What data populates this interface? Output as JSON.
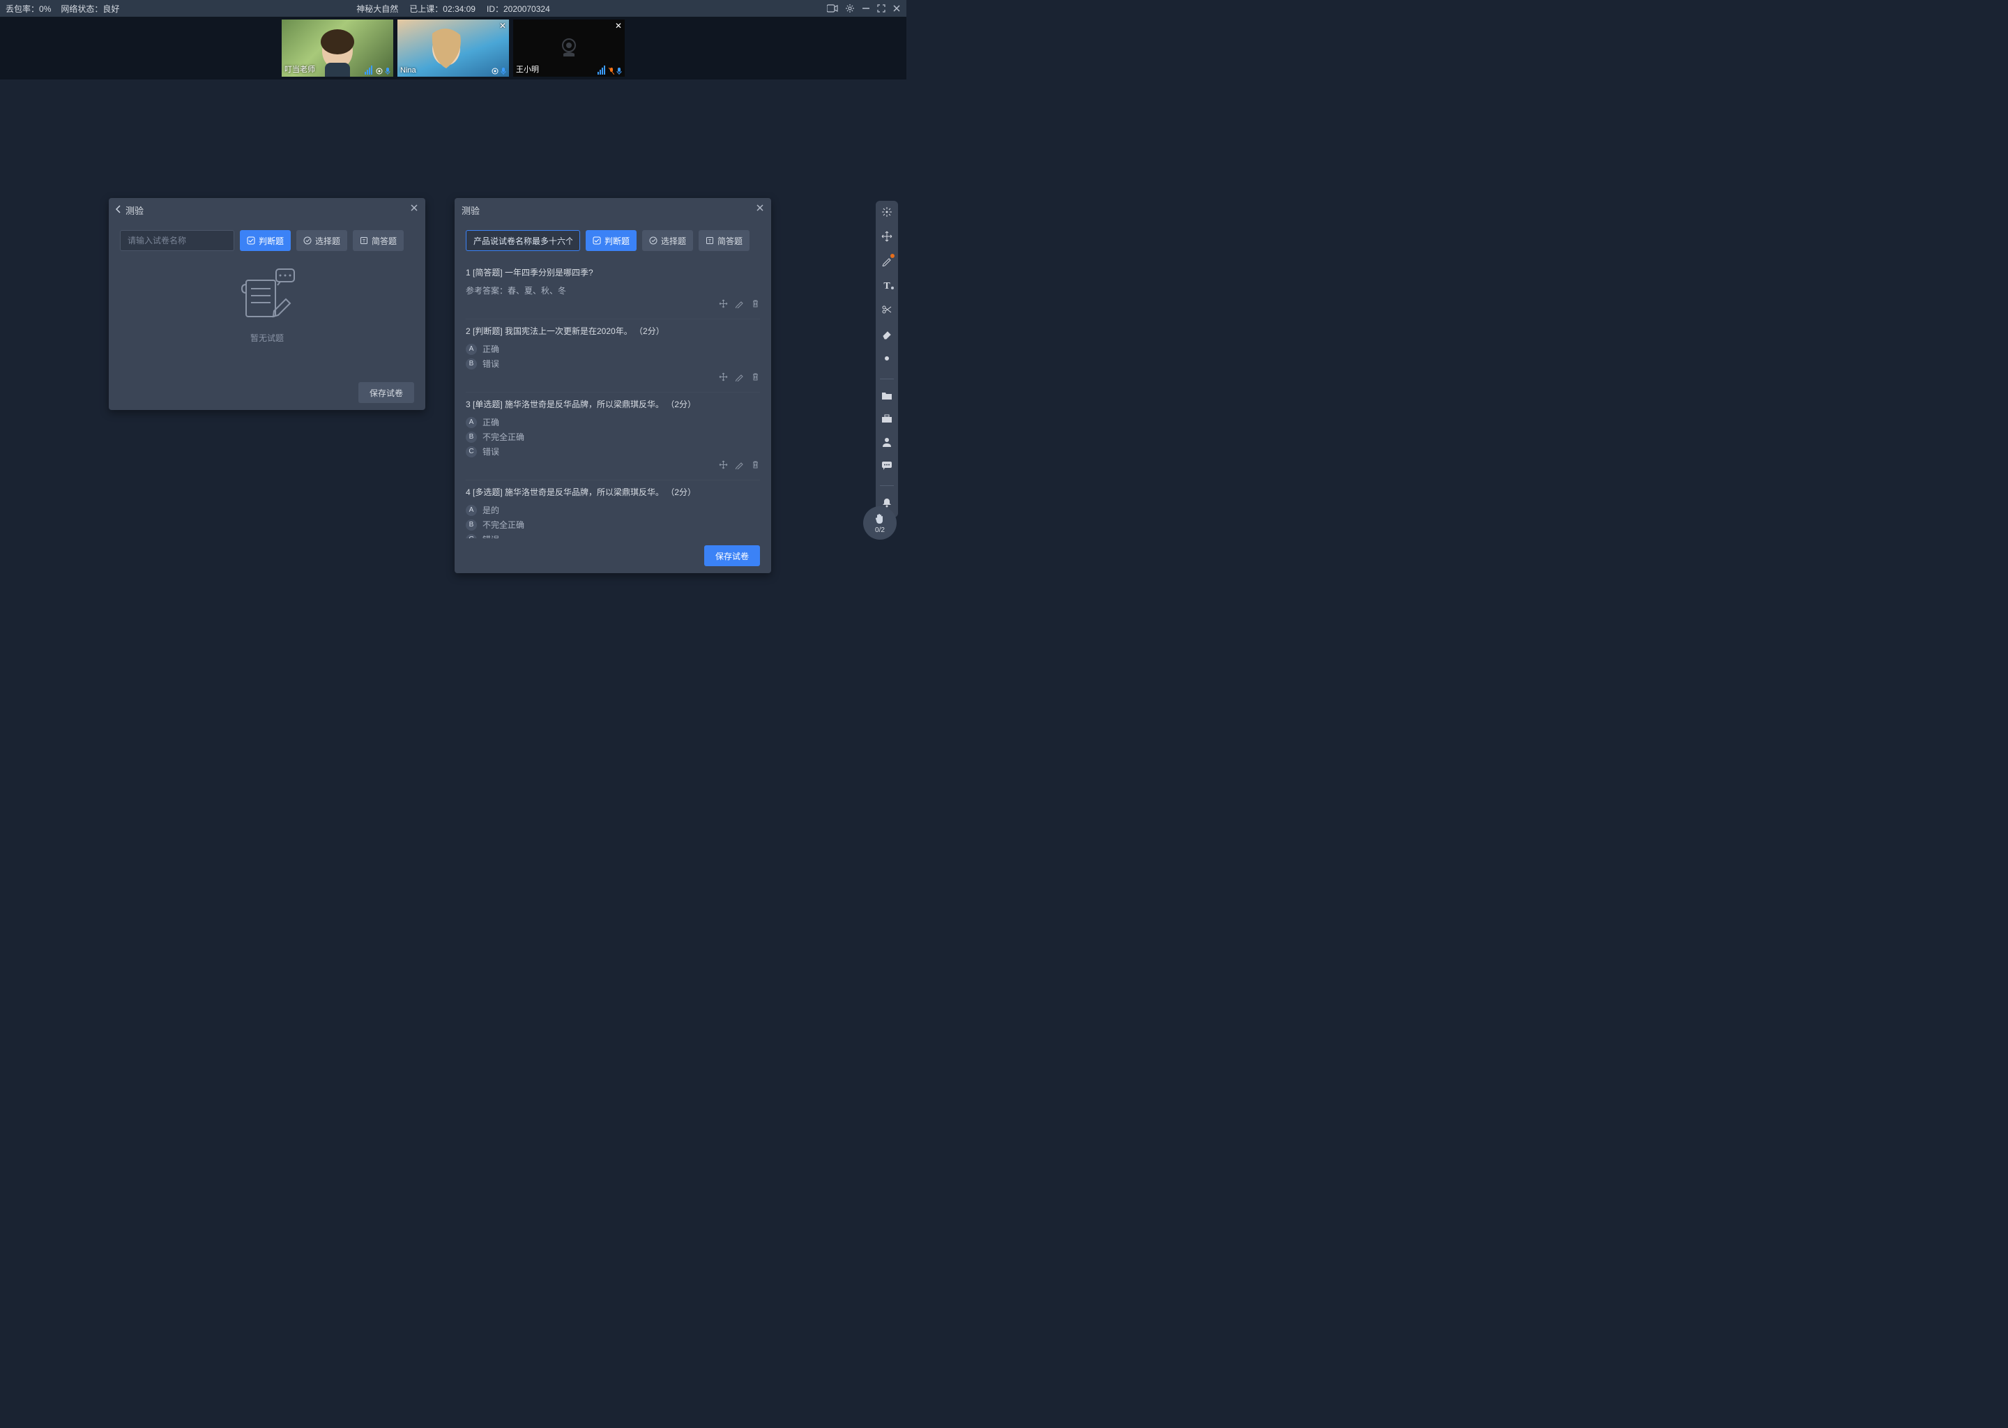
{
  "topbar": {
    "packet_loss_label": "丢包率：",
    "packet_loss_value": "0%",
    "net_label": "网络状态：",
    "net_value": "良好",
    "course_title": "神秘大自然",
    "elapsed_label": "已上课：",
    "elapsed_value": "02:34:09",
    "id_label": "ID：",
    "id_value": "2020070324"
  },
  "participants": [
    {
      "name": "叮当老师",
      "camera": "on",
      "closeable": false,
      "bg": "linear-gradient(135deg,#6b8e4e 0%,#a8c97a 40%,#4e6b3a 100%)"
    },
    {
      "name": "Nina",
      "camera": "on",
      "closeable": true,
      "bg": "linear-gradient(160deg,#e7c9a0 0%,#4aa6d6 60%,#2b6ea0 100%)"
    },
    {
      "name": "王小明",
      "camera": "off",
      "closeable": true,
      "bg": "#000",
      "camera_off_color": "#6b7280"
    }
  ],
  "panel_left": {
    "title": "测验",
    "name_placeholder": "请输入试卷名称",
    "btn_judge": "判断题",
    "btn_choice": "选择题",
    "btn_short": "简答题",
    "empty_text": "暂无试题",
    "save_label": "保存试卷"
  },
  "panel_right": {
    "title": "测验",
    "name_value": "产品说试卷名称最多十六个字",
    "btn_judge": "判断题",
    "btn_choice": "选择题",
    "btn_short": "简答题",
    "save_label": "保存试卷",
    "questions": [
      {
        "idx": "1",
        "tag": "[简答题]",
        "text": "一年四季分别是哪四季?",
        "answer_label": "参考答案：",
        "answer": "春、夏、秋、冬",
        "options": []
      },
      {
        "idx": "2",
        "tag": "[判断题]",
        "text": "我国宪法上一次更新是在2020年。",
        "score": "（2分）",
        "options": [
          {
            "letter": "A",
            "text": "正确"
          },
          {
            "letter": "B",
            "text": "错误"
          }
        ]
      },
      {
        "idx": "3",
        "tag": "[单选题]",
        "text": "施华洛世奇是反华品牌，所以梁鼎琪反华。",
        "score": "（2分）",
        "options": [
          {
            "letter": "A",
            "text": "正确"
          },
          {
            "letter": "B",
            "text": "不完全正确"
          },
          {
            "letter": "C",
            "text": "错误"
          }
        ]
      },
      {
        "idx": "4",
        "tag": "[多选题]",
        "text": "施华洛世奇是反华品牌，所以梁鼎琪反华。",
        "score": "（2分）",
        "options": [
          {
            "letter": "A",
            "text": "是的"
          },
          {
            "letter": "B",
            "text": "不完全正确"
          },
          {
            "letter": "C",
            "text": "错误"
          }
        ]
      }
    ]
  },
  "toolbar_icons": [
    "cursor-click",
    "move",
    "pen",
    "text",
    "scissors",
    "eraser",
    "dot"
  ],
  "toolbar_icons2": [
    "folder",
    "toolbox",
    "person",
    "chat",
    "bell"
  ],
  "hand": {
    "count": "0/2"
  }
}
